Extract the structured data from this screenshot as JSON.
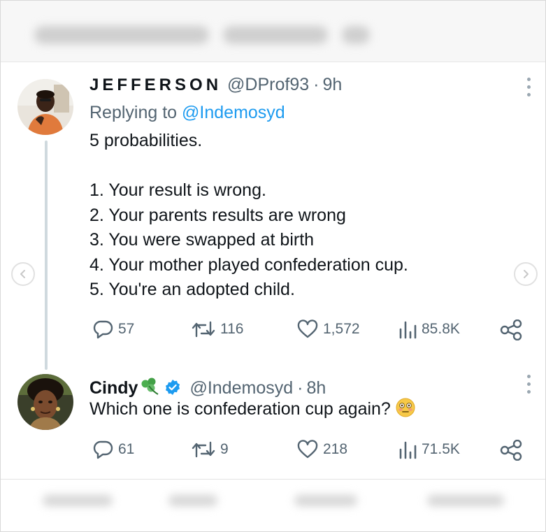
{
  "tweet1": {
    "display_name": "JEFFERSON",
    "handle": "@DProf93",
    "time": "9h",
    "replying_prefix": "Replying to",
    "replying_handle": "@Indemosyd",
    "lines": [
      "5 probabilities.",
      "1. Your result is wrong.",
      "2. Your parents results are wrong",
      "3. You were swapped at birth",
      "4. Your mother played confederation cup.",
      "5. You're an adopted child."
    ],
    "replies": "57",
    "reposts": "116",
    "likes": "1,572",
    "views": "85.8K"
  },
  "tweet2": {
    "display_name": "Cindy",
    "name_emoji": "shamrock-icon",
    "verified": true,
    "handle": "@Indemosyd",
    "time": "8h",
    "text": "Which one is confederation cup again?",
    "text_emoji": "flushed-face-icon",
    "replies": "61",
    "reposts": "9",
    "likes": "218",
    "views": "71.5K"
  },
  "colors": {
    "text": "#0f1419",
    "secondary": "#536471",
    "link": "#1d9bf0",
    "verified": "#1d9bf0",
    "thread_line": "#cfd9de"
  }
}
